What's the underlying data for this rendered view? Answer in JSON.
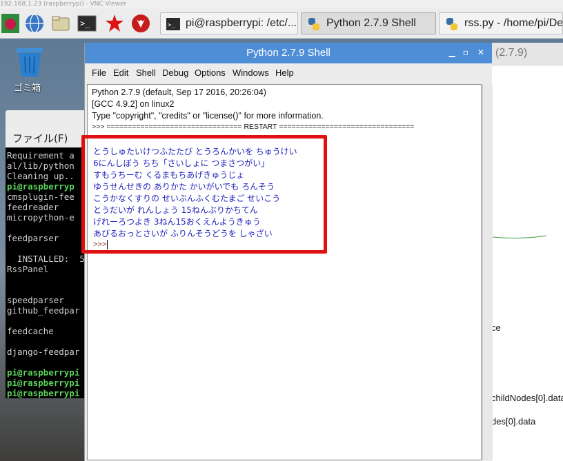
{
  "vnc_title": "192.168.1.23 (raspberrypi) - VNC Viewer",
  "taskbar": {
    "launchers": [
      "raspberry-menu-icon",
      "browser-globe-icon",
      "file-manager-icon",
      "terminal-icon",
      "wolfram-icon",
      "mathematica-wolf-icon"
    ],
    "tasks": [
      {
        "label": "pi@raspberrypi: /etc/...",
        "icon": "terminal-icon",
        "active": false
      },
      {
        "label": "Python 2.7.9 Shell",
        "icon": "python-icon",
        "active": true
      },
      {
        "label": "rss.py - /home/pi/De",
        "icon": "python-icon",
        "active": false
      }
    ]
  },
  "desktop": {
    "trash_label": "ゴミ箱",
    "file_manager_menu": "ファイル(F)"
  },
  "terminal": {
    "lines": [
      {
        "text": "Requirement a",
        "prompt": false
      },
      {
        "text": "al/lib/python",
        "prompt": false
      },
      {
        "text": "Cleaning up..",
        "prompt": false
      },
      {
        "text": "pi@raspberryp",
        "prompt": true
      },
      {
        "text": "cmsplugin-fee",
        "prompt": false
      },
      {
        "text": "feedreader",
        "prompt": false
      },
      {
        "text": "micropython-e",
        "prompt": false
      },
      {
        "text": "",
        "prompt": false
      },
      {
        "text": "feedparser",
        "prompt": false
      },
      {
        "text": "",
        "prompt": false
      },
      {
        "text": "  INSTALLED:  5",
        "prompt": false
      },
      {
        "text": "RssPanel",
        "prompt": false
      },
      {
        "text": "",
        "prompt": false
      },
      {
        "text": "",
        "prompt": false
      },
      {
        "text": "speedparser",
        "prompt": false
      },
      {
        "text": "github_feedpar",
        "prompt": false
      },
      {
        "text": "",
        "prompt": false
      },
      {
        "text": "feedcache",
        "prompt": false
      },
      {
        "text": "",
        "prompt": false
      },
      {
        "text": "django-feedpar",
        "prompt": false
      },
      {
        "text": "",
        "prompt": false
      },
      {
        "text": "pi@raspberrypi",
        "prompt": true
      },
      {
        "text": "pi@raspberrypi",
        "prompt": true
      },
      {
        "text": "pi@raspberrypi",
        "prompt": true
      }
    ]
  },
  "right_window": {
    "title_fragment": "(2.7.9)",
    "text_1": "ce",
    "text_2": "childNodes[0].data",
    "text_3": "des[0].data"
  },
  "idle": {
    "title": "Python 2.7.9 Shell",
    "controls": {
      "minimize": "▁",
      "maximize": "▫",
      "close": "✕"
    },
    "menu": [
      "File",
      "Edit",
      "Shell",
      "Debug",
      "Options",
      "Windows",
      "Help"
    ],
    "banner": [
      "Python 2.7.9 (default, Sep 17 2016, 20:26:04)",
      "[GCC 4.9.2] on linux2",
      "Type \"copyright\", \"credits\" or \"license()\" for more information.",
      ">>> ================================ RESTART ================================"
    ],
    "output": [
      "とうしゅたいけつふたたび とうろんかいを ちゅうけい",
      "6にんしぼう ちち「さいしょに つまさつがい」",
      "すもうちーむ くるまもちあげきゅうじょ",
      "ゆうせんせきの ありかた かいがいでも ろんそう",
      "こうかなくすりの せいぶんふくむたまご せいこう",
      "とうだいが れんしょう 15ねんぶりかちてん",
      "げれーろつよき 3ねん15おくえんようきゅう",
      "あびるおっとさいが ふりんそうどうを しゃざい"
    ],
    "prompt": ">>>"
  }
}
